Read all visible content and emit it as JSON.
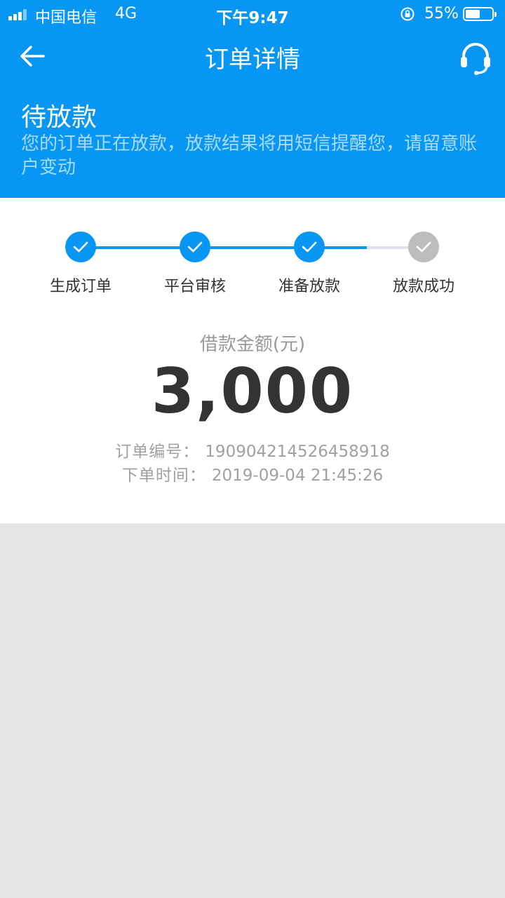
{
  "status_bar": {
    "carrier": "中国电信",
    "network": "4G",
    "time": "下午9:47",
    "battery_percent": "55%",
    "battery_level": 0.55
  },
  "nav": {
    "title": "订单详情",
    "back_icon": "arrow-left-icon",
    "support_icon": "headset-icon"
  },
  "status": {
    "title": "待放款",
    "description": "您的订单正在放款，放款结果将用短信提醒您，请留意账户变动"
  },
  "steps": [
    {
      "label": "生成订单",
      "state": "done"
    },
    {
      "label": "平台审核",
      "state": "done"
    },
    {
      "label": "准备放款",
      "state": "done"
    },
    {
      "label": "放款成功",
      "state": "pending"
    }
  ],
  "loan": {
    "amount_label": "借款金额(元)",
    "amount": "3,000",
    "order_no_label": "订单编号：",
    "order_no": "190904214526458918",
    "order_time_label": "下单时间：",
    "order_time": "2019-09-04 21:45:26"
  },
  "colors": {
    "primary": "#0796f3",
    "pending": "#bdbdbd",
    "background": "#e5e5e5"
  }
}
